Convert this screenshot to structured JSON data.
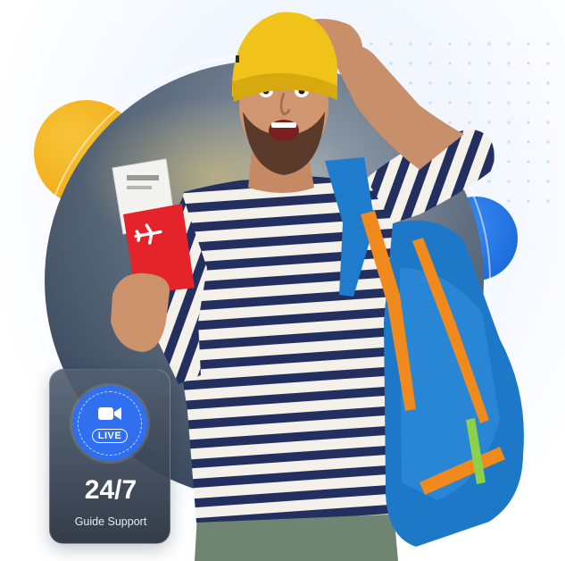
{
  "colors": {
    "accent_yellow": "#f2ae17",
    "accent_blue": "#1f6fe0",
    "live_badge_blue": "#2f6ff0",
    "shirt_stripe_navy": "#23305f",
    "beanie_yellow": "#f0c21a",
    "passport_red": "#e5232a",
    "backpack_blue": "#1e78c8",
    "strap_orange": "#f08a1c"
  },
  "hero": {
    "icons": [
      "plane-icon",
      "video-camera-icon"
    ]
  },
  "support_card": {
    "badge_label": "LIVE",
    "headline": "24/7",
    "caption": "Guide Support"
  }
}
